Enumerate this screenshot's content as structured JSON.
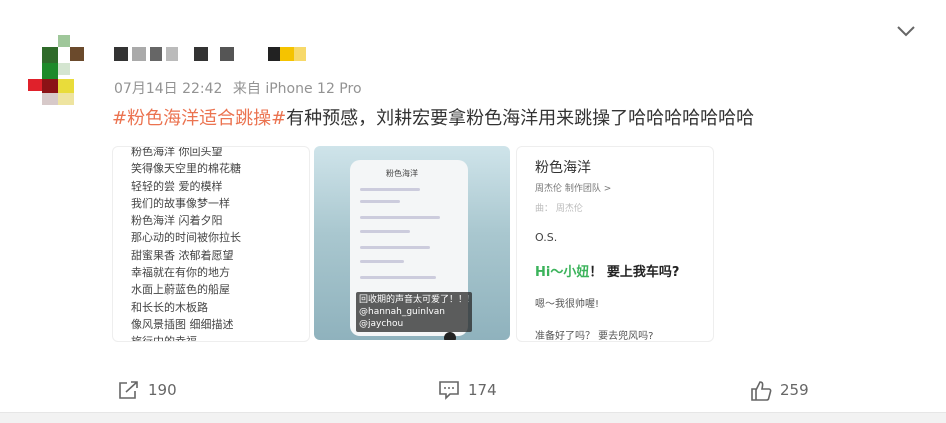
{
  "post": {
    "date": "07月14日 22:42",
    "source": "来自 iPhone 12 Pro",
    "hashtag": "#粉色海洋适合跳操#",
    "text": "有种预感，刘耕宏要拿粉色海洋用来跳操了哈哈哈哈哈哈哈"
  },
  "images": {
    "lyrics": [
      "粉色海洋 你回头望",
      "笑得像天空里的棉花糖",
      "轻轻的尝 爱的模样",
      "我们的故事像梦一样",
      "粉色海洋 闪着夕阳",
      "那心动的时间被你拉长",
      "甜蜜果香 浓郁着愿望",
      "幸福就在有你的地方",
      "水面上蔚蓝色的船屋",
      "和长长的木板路",
      "像风景插图 细细描述",
      "旅行中的幸福"
    ],
    "video": {
      "top_label": "粉色海洋",
      "subtitle_1": "回收期的声音太可爱了！！！",
      "subtitle_2": "@hannah_guinlvan",
      "subtitle_3": "@jaychou"
    },
    "song": {
      "title": "粉色海洋",
      "artist": "周杰伦  制作团队 >",
      "composer": "曲：  周杰伦",
      "os": "O.S.",
      "hi_green": "Hi～小妞",
      "hi_rest": "！ 要上我车吗?",
      "line1": "嗯～我很帅喔!",
      "line2": "准备好了吗？ 要去兜风吗?"
    }
  },
  "actions": {
    "share_count": "190",
    "comment_count": "174",
    "like_count": "259"
  },
  "colors": {
    "hashtag": "#eb7350",
    "green": "#3bb35b"
  }
}
